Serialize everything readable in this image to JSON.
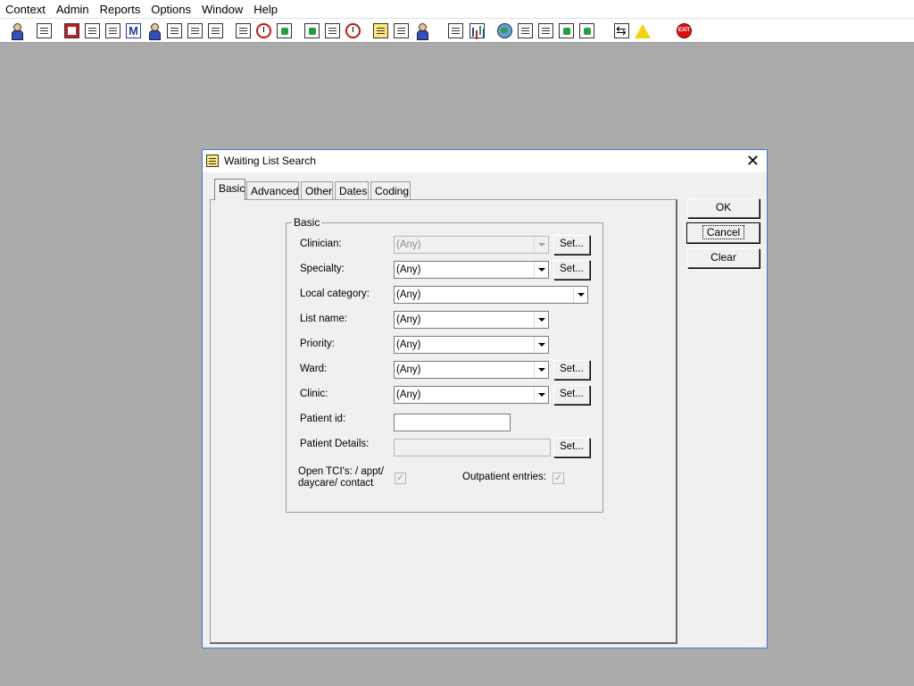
{
  "menu": [
    "Context",
    "Admin",
    "Reports",
    "Options",
    "Window",
    "Help"
  ],
  "toolbar": {
    "icons": [
      "person-icon",
      "document-icon",
      "book-icon",
      "edit-icon",
      "list-icon",
      "m-icon",
      "patient-icon",
      "notes-icon",
      "flag-icon",
      "flag-alt-icon",
      "tools-icon",
      "clock-icon",
      "screen-icon",
      "monitor-icon",
      "report-icon",
      "target-icon",
      "notepad-icon",
      "bed-icon",
      "transfer-icon",
      "page-icon",
      "chart-icon",
      "globe-icon",
      "checklist-icon",
      "check-down-icon",
      "green-arrow-icon",
      "green-check-icon",
      "swap-icon",
      "warning-icon",
      "exit-icon"
    ]
  },
  "dialog": {
    "title": "Waiting List Search",
    "tabs": [
      "Basic",
      "Advanced",
      "Other",
      "Dates",
      "Coding"
    ],
    "active_tab": "Basic",
    "group_label": "Basic",
    "fields": {
      "clinician": {
        "label": "Clinician:",
        "value": "(Any)"
      },
      "specialty": {
        "label": "Specialty:",
        "value": "(Any)"
      },
      "local_category": {
        "label": "Local category:",
        "value": "(Any)"
      },
      "list_name": {
        "label": "List name:",
        "value": "(Any)"
      },
      "priority": {
        "label": "Priority:",
        "value": "(Any)"
      },
      "ward": {
        "label": "Ward:",
        "value": "(Any)"
      },
      "clinic": {
        "label": "Clinic:",
        "value": "(Any)"
      },
      "patient_id": {
        "label": "Patient id:",
        "value": ""
      },
      "patient_details": {
        "label": "Patient Details:",
        "value": ""
      },
      "open_tcis": {
        "label_line1": "Open TCI's: / appt/",
        "label_line2": "daycare/ contact",
        "checked": true
      },
      "outpatient": {
        "label": "Outpatient entries:",
        "checked": true
      }
    },
    "set_label": "Set...",
    "check_mark": "✓",
    "buttons": {
      "ok": "OK",
      "cancel": "Cancel",
      "clear": "Clear"
    }
  }
}
